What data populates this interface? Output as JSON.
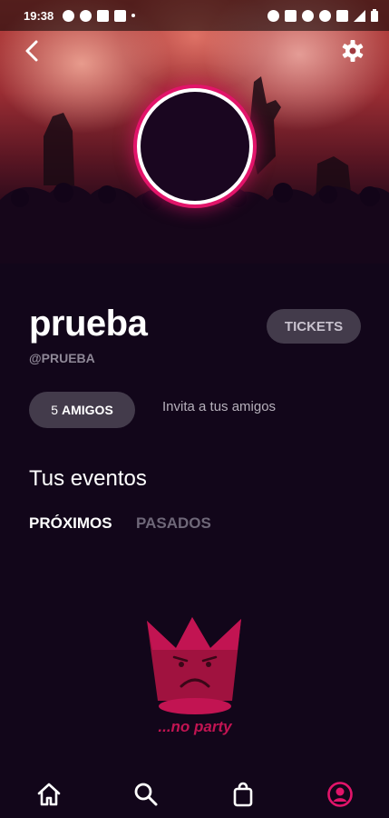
{
  "status_bar": {
    "time": "19:38",
    "left_icons": [
      "gear-icon",
      "whatsapp-icon",
      "news-icon",
      "network-icon",
      "dot-icon"
    ],
    "right_icons": [
      "alarm-icon",
      "nfc-icon",
      "mute-icon",
      "hotspot-icon",
      "5g-icon",
      "signal-icon",
      "battery-icon"
    ]
  },
  "header": {
    "back_icon": "chevron-left-icon",
    "settings_icon": "gear-icon"
  },
  "profile": {
    "name": "prueba",
    "handle": "@PRUEBA",
    "tickets_label": "TICKETS",
    "friends_count": "5",
    "friends_label": "AMIGOS",
    "invite_text": "Invita a tus amigos"
  },
  "events": {
    "title": "Tus eventos",
    "tabs": [
      {
        "label": "PRÓXIMOS",
        "active": true
      },
      {
        "label": "PASADOS",
        "active": false
      }
    ],
    "empty_text": "...no party"
  },
  "bottom_nav": [
    {
      "icon": "home-icon"
    },
    {
      "icon": "search-icon"
    },
    {
      "icon": "shopping-bag-icon"
    },
    {
      "icon": "profile-icon",
      "active": true
    }
  ],
  "colors": {
    "background": "#12061a",
    "accent": "#e2146a",
    "pill": "#433b4b",
    "muted": "#8e8796",
    "empty_logo": "#c21452"
  }
}
